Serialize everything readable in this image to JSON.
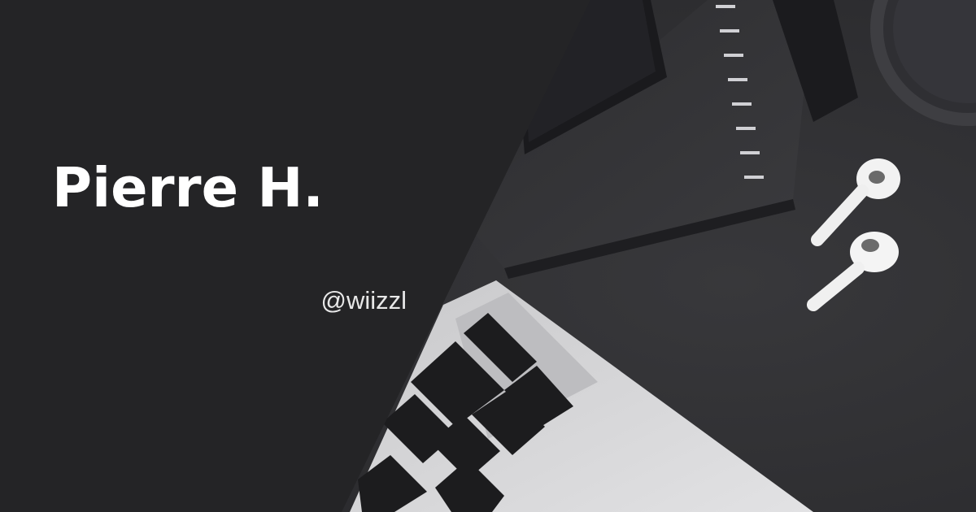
{
  "profile": {
    "name": "Pierre H.",
    "handle": "@wiizzl"
  },
  "colors": {
    "panel": "#242426",
    "photo_background": "#2e2e31",
    "text_primary": "#ffffff",
    "text_secondary": "#e8e8e8"
  },
  "illustration": {
    "objects": [
      "laptop",
      "spiral-notebook",
      "smartphone",
      "airpods",
      "glass"
    ]
  }
}
